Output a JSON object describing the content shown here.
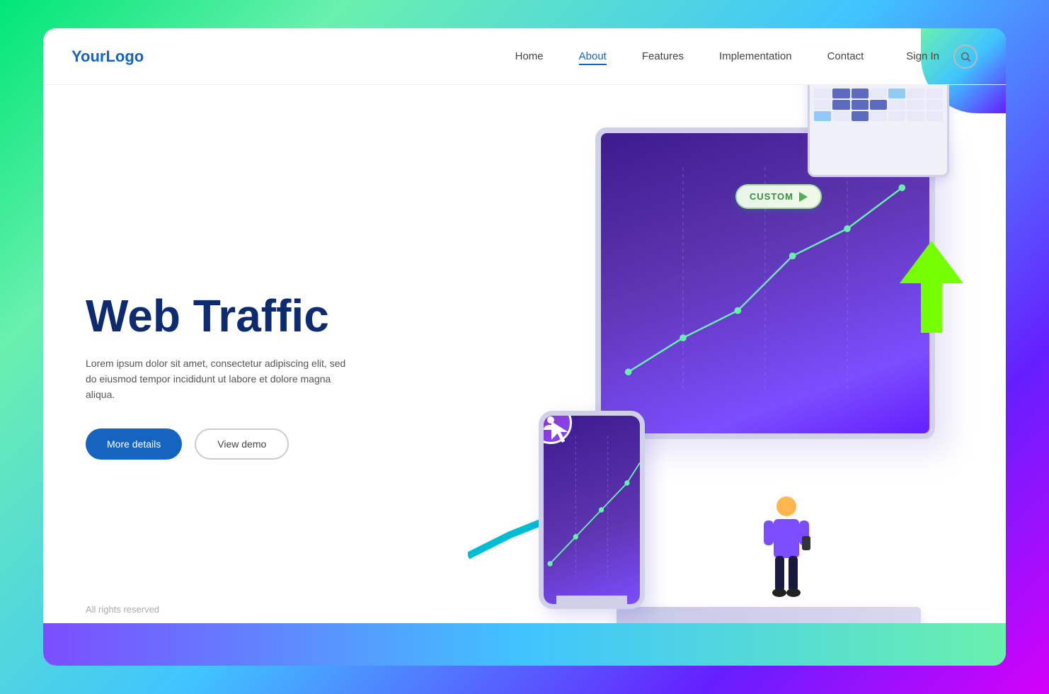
{
  "brand": {
    "logo": "YourLogo"
  },
  "navbar": {
    "links": [
      {
        "label": "Home",
        "active": false
      },
      {
        "label": "About",
        "active": true
      },
      {
        "label": "Features",
        "active": false
      },
      {
        "label": "Implementation",
        "active": false
      },
      {
        "label": "Contact",
        "active": false
      }
    ],
    "sign_in": "Sign In"
  },
  "hero": {
    "title": "Web Traffic",
    "description": "Lorem ipsum dolor sit amet, consectetur adipiscing elit, sed do eiusmod tempor incididunt ut labore et dolore magna aliqua.",
    "btn_primary": "More details",
    "btn_outline": "View demo"
  },
  "badge": {
    "label": "CUSTOM"
  },
  "footer": {
    "copy": "All rights reserved"
  },
  "icons": {
    "search": "🔍"
  }
}
